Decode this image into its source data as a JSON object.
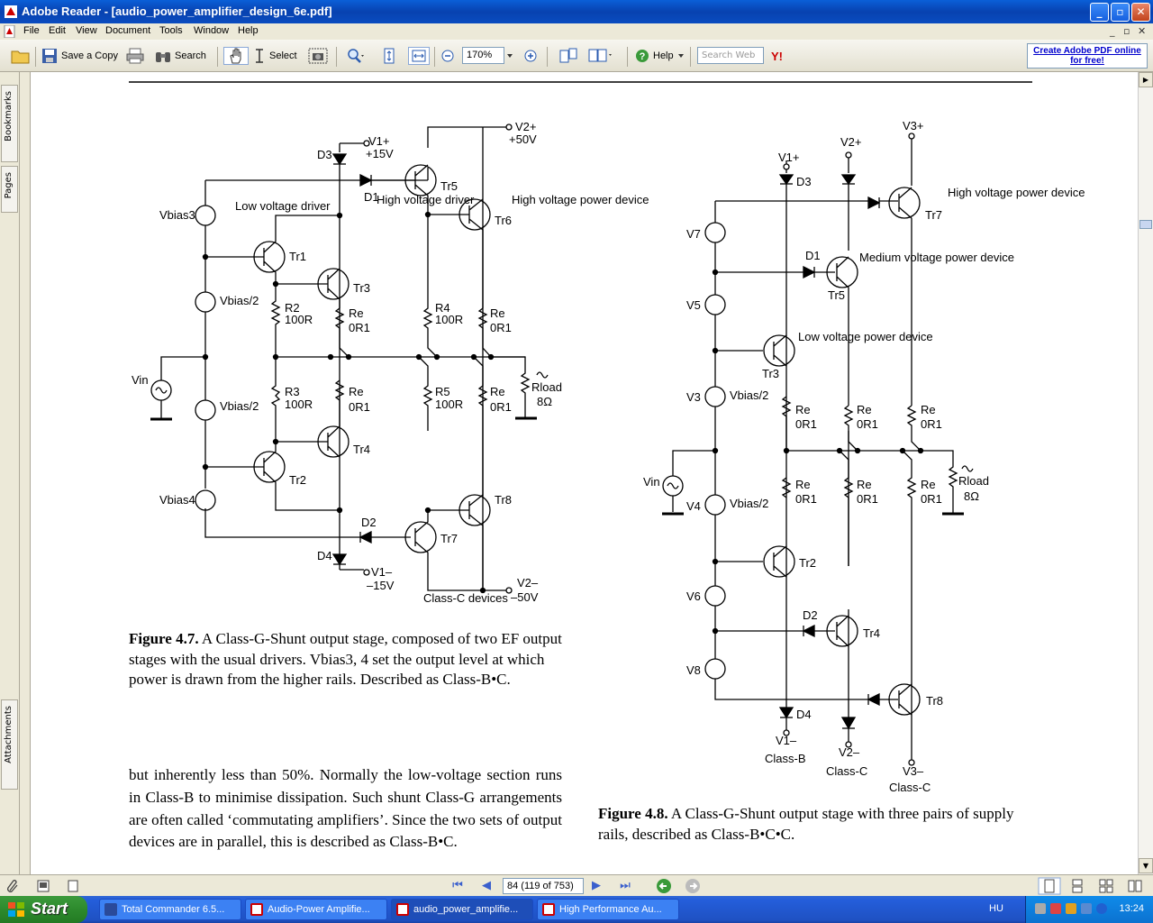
{
  "window": {
    "title": "Adobe Reader - [audio_power_amplifier_design_6e.pdf]"
  },
  "menu": {
    "items": [
      "File",
      "Edit",
      "View",
      "Document",
      "Tools",
      "Window",
      "Help"
    ]
  },
  "toolbar": {
    "save_copy": "Save a Copy",
    "search": "Search",
    "select": "Select",
    "zoom": "170%",
    "help": "Help",
    "search_web_placeholder": "Search Web",
    "yahoo": "Y!",
    "promo": "Create Adobe PDF online for free!"
  },
  "navtabs": {
    "bookmarks": "Bookmarks",
    "pages": "Pages",
    "attachments": "Attachments"
  },
  "document": {
    "fig47_caption_label": "Figure 4.7.",
    "fig47_caption_text": "A Class-G-Shunt output stage, composed of two EF output stages with the usual drivers. Vbias3, 4 set the output level at which power is drawn from the higher rails. Described as Class-B•C.",
    "body_text": "but inherently less than 50%. Normally the low-voltage section runs in Class-B to minimise dissipation. Such shunt Class-G arrangements are often called ‘commutating amplifiers’. Since the two sets of output devices are in parallel, this is described as Class-B•C.",
    "fig48_caption_label": "Figure 4.8.",
    "fig48_caption_text": "A Class-G-Shunt output stage with three pairs of supply rails, described as Class-B•C•C.",
    "fig47_labels": {
      "v1p": "V1+",
      "v1p_val": "+15V",
      "v2p": "V2+",
      "v2p_val": "+50V",
      "v1m": "V1–",
      "v1m_val": "–15V",
      "v2m": "V2–",
      "v2m_val": "–50V",
      "d3": "D3",
      "d1": "D1",
      "d2": "D2",
      "d4": "D4",
      "tr1": "Tr1",
      "tr2": "Tr2",
      "tr3": "Tr3",
      "tr4": "Tr4",
      "tr5": "Tr5",
      "tr6": "Tr6",
      "tr7": "Tr7",
      "tr8": "Tr8",
      "low_driver": "Low voltage driver",
      "high_driver": "High voltage driver",
      "high_power": "High voltage power device",
      "vbias3": "Vbias3",
      "vbias4": "Vbias4",
      "vbias_half": "Vbias/2",
      "vin": "Vin",
      "r2": "R2",
      "r2_val": "100R",
      "r3": "R3",
      "r3_val": "100R",
      "r4": "R4",
      "r4_val": "100R",
      "r5": "R5",
      "r5_val": "100R",
      "re": "Re",
      "re_val": "0R1",
      "rload": "Rload",
      "rload_val": "8Ω",
      "classc": "Class-C devices"
    },
    "fig48_labels": {
      "v1p": "V1+",
      "v2p": "V2+",
      "v3p": "V3+",
      "v1m": "V1–",
      "v2m": "V2–",
      "v3m": "V3–",
      "d1": "D1",
      "d2": "D2",
      "d3": "D3",
      "d4": "D4",
      "tr2": "Tr2",
      "tr3": "Tr3",
      "tr4": "Tr4",
      "tr5": "Tr5",
      "tr7": "Tr7",
      "tr8": "Tr8",
      "v3": "V3",
      "v4": "V4",
      "v5": "V5",
      "v6": "V6",
      "v7": "V7",
      "v8": "V8",
      "high_power": "High voltage power device",
      "medium_power": "Medium voltage power device",
      "low_power": "Low voltage power device",
      "vbias_half": "Vbias/2",
      "vin": "Vin",
      "re": "Re",
      "re_val": "0R1",
      "rload": "Rload",
      "rload_val": "8Ω",
      "classb": "Class-B",
      "classc": "Class-C"
    }
  },
  "status": {
    "page": "84 (119 of 753)"
  },
  "taskbar": {
    "start": "Start",
    "tasks": [
      "Total Commander 6.5...",
      "Audio-Power Amplifie...",
      "audio_power_amplifie...",
      "High Performance Au..."
    ],
    "lang": "HU",
    "clock": "13:24"
  }
}
